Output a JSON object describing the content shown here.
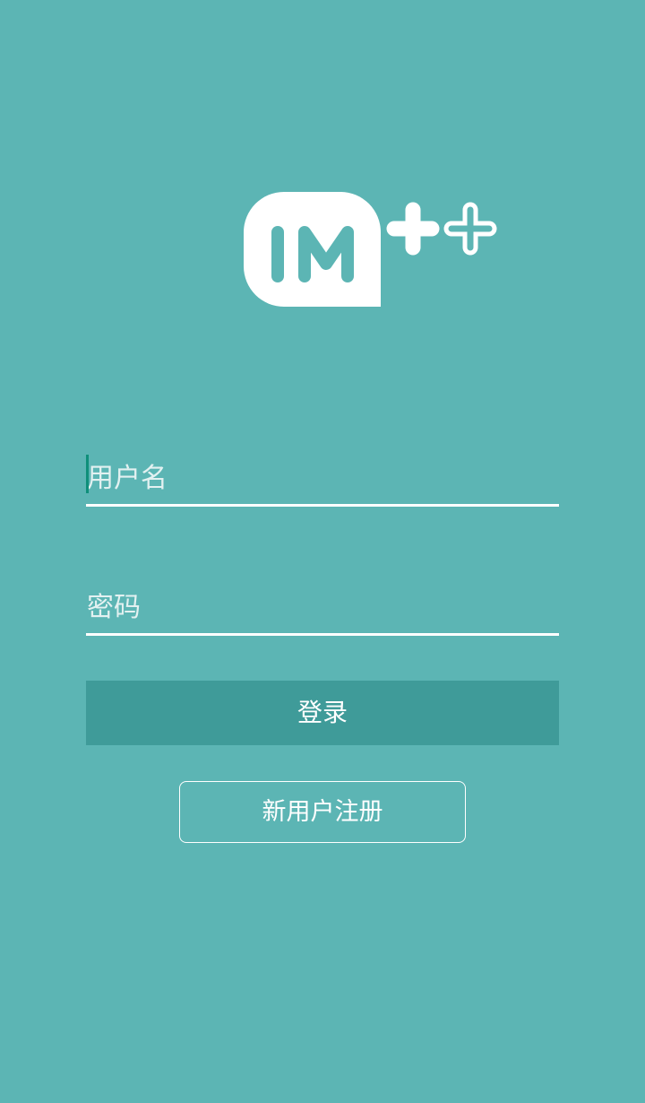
{
  "theme": {
    "background": "#5cb5b4",
    "login_button_bg": "#3f9b99",
    "caret": "#0f8f7a",
    "text": "#ffffff"
  },
  "logo": {
    "text": "IM",
    "icon": "im-plus-plus-logo-icon"
  },
  "form": {
    "username": {
      "value": "",
      "placeholder": "用户名"
    },
    "password": {
      "value": "",
      "placeholder": "密码"
    },
    "login_label": "登录",
    "register_label": "新用户注册"
  }
}
